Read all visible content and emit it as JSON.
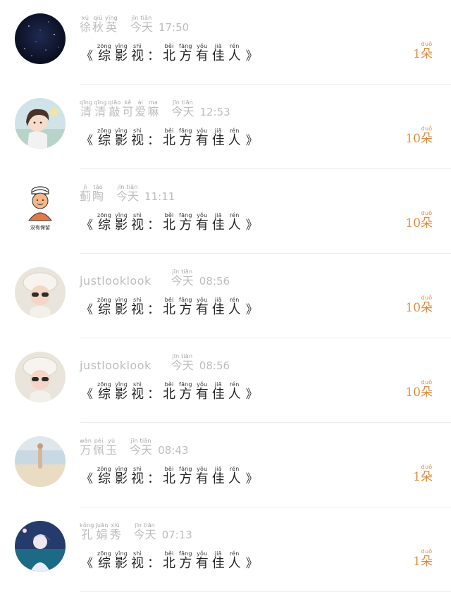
{
  "message": {
    "open": "《",
    "close": "》",
    "colon": "：",
    "words": [
      {
        "py": "zōng",
        "hz": "综"
      },
      {
        "py": "yǐng",
        "hz": "影"
      },
      {
        "py": "shì",
        "hz": "视"
      },
      {
        "py": "běi",
        "hz": "北"
      },
      {
        "py": "fāng",
        "hz": "方"
      },
      {
        "py": "yǒu",
        "hz": "有"
      },
      {
        "py": "jiā",
        "hz": "佳"
      },
      {
        "py": "rén",
        "hz": "人"
      }
    ]
  },
  "day": {
    "py": "jīn tiān",
    "hz": "今天"
  },
  "unit": {
    "py": "duǒ",
    "hz": "朵"
  },
  "rows": [
    {
      "name_words": [
        {
          "py": "xú",
          "hz": "徐"
        },
        {
          "py": "qiū",
          "hz": "秋"
        },
        {
          "py": "yīng",
          "hz": "英"
        }
      ],
      "name_latin": "",
      "time": "17:50",
      "count": "1"
    },
    {
      "name_words": [
        {
          "py": "qīng",
          "hz": "清"
        },
        {
          "py": "qīng",
          "hz": "清"
        },
        {
          "py": "qiāo",
          "hz": "敲"
        },
        {
          "py": "kě",
          "hz": "可"
        },
        {
          "py": "ài",
          "hz": "爱"
        },
        {
          "py": "ma",
          "hz": "嘛"
        }
      ],
      "name_latin": "",
      "time": "12:53",
      "count": "10"
    },
    {
      "name_words": [
        {
          "py": "jì",
          "hz": "蓟"
        },
        {
          "py": "táo",
          "hz": "陶"
        }
      ],
      "name_latin": "",
      "time": "11:11",
      "count": "10"
    },
    {
      "name_words": [],
      "name_latin": "justlooklook",
      "time": "08:56",
      "count": "10"
    },
    {
      "name_words": [],
      "name_latin": "justlooklook",
      "time": "08:56",
      "count": "10"
    },
    {
      "name_words": [
        {
          "py": "wàn",
          "hz": "万"
        },
        {
          "py": "pèi",
          "hz": "佩"
        },
        {
          "py": "yù",
          "hz": "玉"
        }
      ],
      "name_latin": "",
      "time": "08:43",
      "count": "1"
    },
    {
      "name_words": [
        {
          "py": "kǒng",
          "hz": "孔"
        },
        {
          "py": "juān",
          "hz": "娟"
        },
        {
          "py": "xiù",
          "hz": "秀"
        }
      ],
      "name_latin": "",
      "time": "07:13",
      "count": "1"
    }
  ],
  "avatar3_caption": "没有保留",
  "avatars": [
    "night-sky-avatar",
    "cartoon-girl-avatar",
    "cartoon-man-avatar",
    "child-hat-avatar",
    "child-hat-avatar",
    "beach-photo-avatar",
    "anime-avatar"
  ]
}
